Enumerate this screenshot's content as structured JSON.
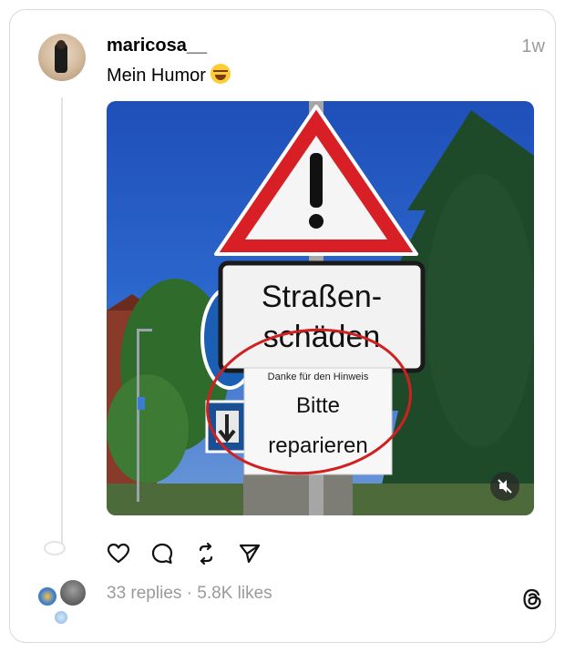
{
  "post": {
    "username": "maricosa__",
    "time": "1w",
    "caption": "Mein Humor",
    "caption_emoji": "face-with-tears-of-joy-icon"
  },
  "media": {
    "sign_top_line1": "Straßen-",
    "sign_top_line2": "schäden",
    "note_small": "Danke für den Hinweis",
    "note_line1": "Bitte",
    "note_line2": "reparieren"
  },
  "footer": {
    "replies": "33 replies",
    "separator": "·",
    "likes": "5.8K likes"
  },
  "colors": {
    "sky": "#2b66cc",
    "sign_red": "#d81f26",
    "circle_annotation": "#d02020",
    "muted_text": "#9a9a9a"
  }
}
